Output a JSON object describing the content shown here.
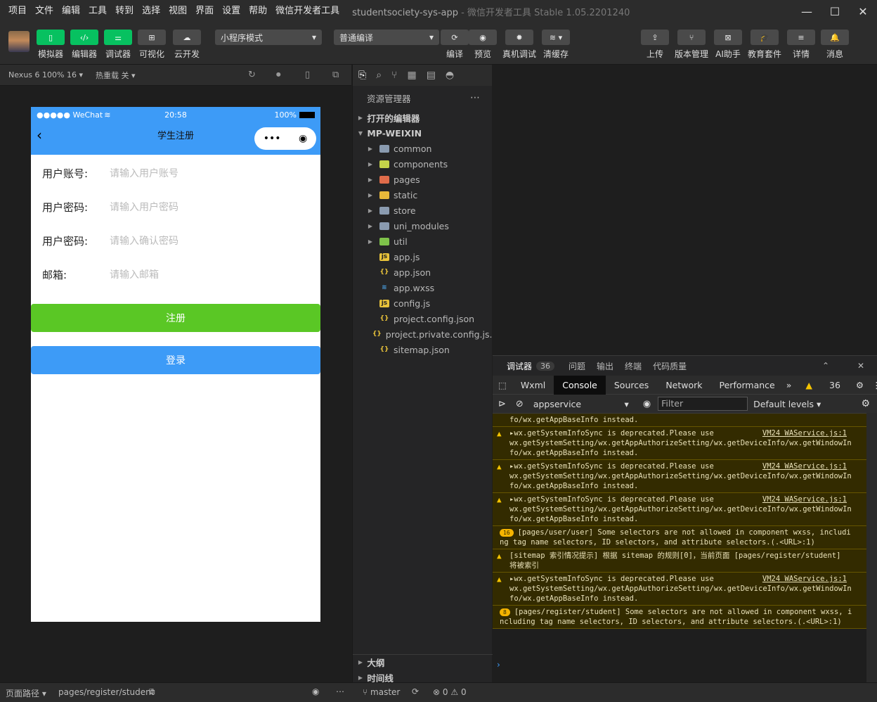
{
  "menu": [
    "项目",
    "文件",
    "编辑",
    "工具",
    "转到",
    "选择",
    "视图",
    "界面",
    "设置",
    "帮助",
    "微信开发者工具"
  ],
  "window": {
    "project": "studentsociety-sys-app",
    "app": "- 微信开发者工具 Stable 1.05.2201240"
  },
  "toolbar": {
    "left": [
      {
        "label": "模拟器",
        "icon": "phone-icon"
      },
      {
        "label": "编辑器",
        "icon": "code-icon"
      },
      {
        "label": "调试器",
        "icon": "sliders-icon"
      },
      {
        "label": "可视化",
        "icon": "layout-icon"
      },
      {
        "label": "云开发",
        "icon": "cloud-icon"
      }
    ],
    "mode": "小程序模式",
    "compile": "普通编译",
    "mid": [
      {
        "label": "编译",
        "icon": "refresh-icon"
      },
      {
        "label": "预览",
        "icon": "eye-icon"
      },
      {
        "label": "真机调试",
        "icon": "bug-icon"
      },
      {
        "label": "清缓存",
        "icon": "layers-icon"
      }
    ],
    "right": [
      {
        "label": "上传",
        "icon": "upload-icon"
      },
      {
        "label": "版本管理",
        "icon": "branch-icon"
      },
      {
        "label": "AI助手",
        "icon": "ai-icon"
      },
      {
        "label": "教育套件",
        "icon": "mortarboard-icon"
      },
      {
        "label": "详情",
        "icon": "menu-icon"
      },
      {
        "label": "消息",
        "icon": "bell-icon"
      }
    ]
  },
  "simbar": {
    "device": "Nexus 6 100% 16",
    "hotreload": "热重载 关"
  },
  "phone": {
    "carrier": "●●●●● WeChat",
    "time": "20:58",
    "battery": "100%",
    "title": "学生注册",
    "fields": [
      {
        "label": "用户账号:",
        "placeholder": "请输入用户账号"
      },
      {
        "label": "用户密码:",
        "placeholder": "请输入用户密码"
      },
      {
        "label": "用户密码:",
        "placeholder": "请输入确认密码"
      },
      {
        "label": "邮箱:",
        "placeholder": "请输入邮箱"
      }
    ],
    "register": "注册",
    "login": "登录",
    "green": "#5ac725",
    "blue": "#3d9bf7"
  },
  "explorer": {
    "title": "资源管理器",
    "open_editors": "打开的编辑器",
    "root": "MP-WEIXIN",
    "items": [
      {
        "name": "common",
        "type": "folder",
        "color": "#8a9bb0"
      },
      {
        "name": "components",
        "type": "folder",
        "color": "#c5d34a"
      },
      {
        "name": "pages",
        "type": "folder",
        "color": "#e06c4a"
      },
      {
        "name": "static",
        "type": "folder",
        "color": "#e8b93a"
      },
      {
        "name": "store",
        "type": "folder",
        "color": "#8a9bb0"
      },
      {
        "name": "uni_modules",
        "type": "folder",
        "color": "#8a9bb0"
      },
      {
        "name": "util",
        "type": "folder",
        "color": "#7ec24a"
      },
      {
        "name": "app.js",
        "type": "js"
      },
      {
        "name": "app.json",
        "type": "json"
      },
      {
        "name": "app.wxss",
        "type": "css"
      },
      {
        "name": "config.js",
        "type": "js"
      },
      {
        "name": "project.config.json",
        "type": "json"
      },
      {
        "name": "project.private.config.js...",
        "type": "json"
      },
      {
        "name": "sitemap.json",
        "type": "json"
      }
    ],
    "outline": "大纲",
    "timeline": "时间线"
  },
  "devtools": {
    "top_tabs": [
      "调试器",
      "问题",
      "输出",
      "终端",
      "代码质量"
    ],
    "count": "36",
    "tabs": [
      "Wxml",
      "Console",
      "Sources",
      "Network",
      "Performance"
    ],
    "warn_count": "36",
    "context": "appservice",
    "filter_placeholder": "Filter",
    "levels": "Default levels",
    "messages": [
      {
        "text": "wx.getSystemSetting/wx.getAppAuthorizeSetting/wx.getDeviceInfo/wx.getWindowInfo/wx.getAppBaseInfo instead.",
        "src": "",
        "badge": ""
      },
      {
        "text": "▸wx.getSystemInfoSync is deprecated.Please use\nwx.getSystemSetting/wx.getAppAuthorizeSetting/wx.getDeviceInfo/wx.getWindowInfo/wx.getAppBaseInfo instead.",
        "src": "VM24 WAService.js:1",
        "badge": ""
      },
      {
        "text": "▸wx.getSystemInfoSync is deprecated.Please use\nwx.getSystemSetting/wx.getAppAuthorizeSetting/wx.getDeviceInfo/wx.getWindowInfo/wx.getAppBaseInfo instead.",
        "src": "VM24 WAService.js:1",
        "badge": ""
      },
      {
        "text": "▸wx.getSystemInfoSync is deprecated.Please use\nwx.getSystemSetting/wx.getAppAuthorizeSetting/wx.getDeviceInfo/wx.getWindowInfo/wx.getAppBaseInfo instead.",
        "src": "VM24 WAService.js:1",
        "badge": ""
      },
      {
        "text": "[pages/user/user] Some selectors are not allowed in component wxss, including tag name selectors, ID selectors, and attribute selectors.(.<URL>:1)",
        "src": "",
        "badge": "16"
      },
      {
        "text": "[sitemap 索引情况提示] 根据 sitemap 的规则[0]，当前页面 [pages/register/student] 将被索引",
        "src": "",
        "badge": ""
      },
      {
        "text": "▸wx.getSystemInfoSync is deprecated.Please use\nwx.getSystemSetting/wx.getAppAuthorizeSetting/wx.getDeviceInfo/wx.getWindowInfo/wx.getAppBaseInfo instead.",
        "src": "VM24 WAService.js:1",
        "badge": ""
      },
      {
        "text": "[pages/register/student] Some selectors are not allowed in component wxss, including tag name selectors, ID selectors, and attribute selectors.(.<URL>:1)",
        "src": "",
        "badge": "8"
      }
    ]
  },
  "bottom": {
    "path_label": "页面路径",
    "path": "pages/register/student",
    "branch": "master",
    "errors": "0",
    "warnings": "0"
  }
}
